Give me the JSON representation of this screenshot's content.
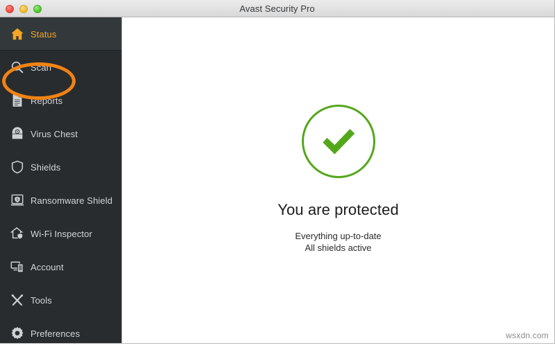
{
  "window": {
    "title": "Avast Security Pro",
    "controls": [
      {
        "name": "close-button",
        "label": "Close"
      },
      {
        "name": "minimize-button",
        "label": "Minimize"
      },
      {
        "name": "maximize-button",
        "label": "Maximize"
      }
    ]
  },
  "sidebar": {
    "items": [
      {
        "label": "Status",
        "icon": "home-icon",
        "active": true
      },
      {
        "label": "Scan",
        "icon": "magnifier-icon",
        "active": false
      },
      {
        "label": "Reports",
        "icon": "document-icon",
        "active": false
      },
      {
        "label": "Virus Chest",
        "icon": "vault-icon",
        "active": false
      },
      {
        "label": "Shields",
        "icon": "shield-icon",
        "active": false
      },
      {
        "label": "Ransomware Shield",
        "icon": "laptop-shield-icon",
        "active": false
      },
      {
        "label": "Wi-Fi Inspector",
        "icon": "house-shield-icon",
        "active": false
      },
      {
        "label": "Account",
        "icon": "devices-icon",
        "active": false
      },
      {
        "label": "Tools",
        "icon": "wrench-screwdriver-icon",
        "active": false
      },
      {
        "label": "Preferences",
        "icon": "gear-icon",
        "active": false
      }
    ]
  },
  "annotation": {
    "shape": "ellipse",
    "target": "Scan",
    "color": "#f08313"
  },
  "main": {
    "status_icon": "green-check-circle-icon",
    "headline": "You are protected",
    "detail_line_1": "Everything up-to-date",
    "detail_line_2": "All shields active",
    "accent_color": "#54a71b"
  },
  "watermark": {
    "text": "wsxdn.com"
  }
}
